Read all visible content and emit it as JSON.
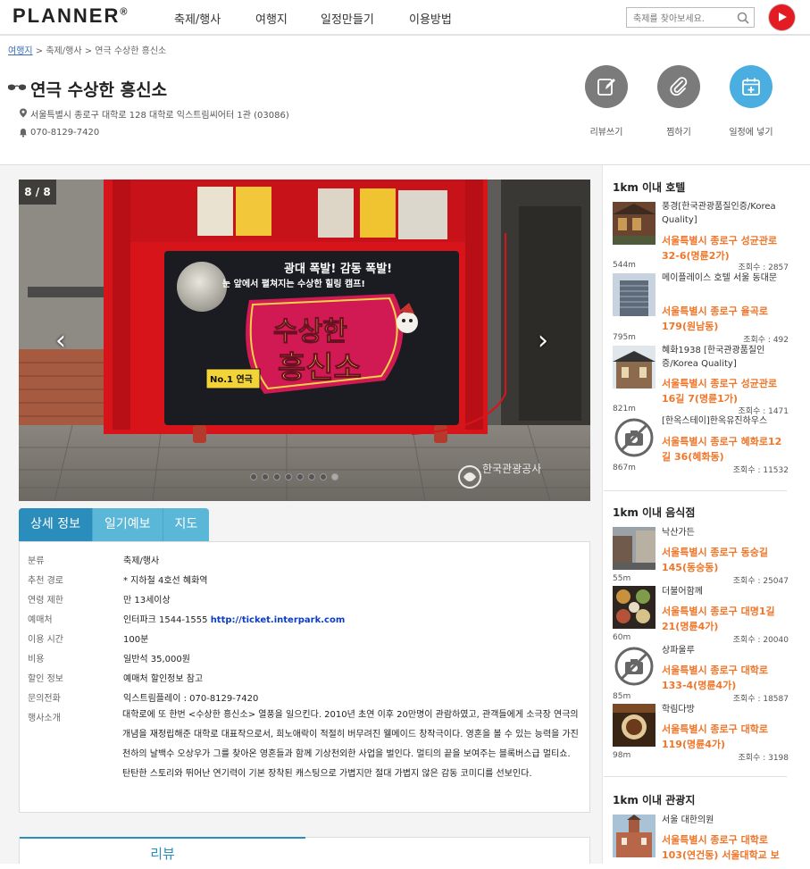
{
  "header": {
    "logo": "PLANNER",
    "logo_mark": "®",
    "nav": [
      "축제/행사",
      "여행지",
      "일정만들기",
      "이용방법"
    ],
    "search_placeholder": "축제를 찾아보세요."
  },
  "breadcrumb": {
    "home": "여행지",
    "cat": "축제/행사",
    "current": "연극 수상한 흥신소"
  },
  "title": "연극 수상한 흥신소",
  "address": "서울특별시 종로구 대학로 128 대학로 익스트림씨어터 1관 (03086)",
  "phone": "070-8129-7420",
  "actions": {
    "review": "리뷰쓰기",
    "like": "찜하기",
    "schedule": "일정에 넣기"
  },
  "slider": {
    "counter": "8 / 8",
    "sign_top": "광대 폭발! 감동 폭발!",
    "sign_sub": "눈 앞에서 펼쳐지는 수상한 힐링 캠프!",
    "sign_main1": "수상한",
    "sign_main2": "흥신소",
    "sign_badge": "No.1 연극",
    "watermark": "한국관광공사",
    "dots": 8,
    "active_dot": 8
  },
  "tabs": [
    "상세 정보",
    "일기예보",
    "지도"
  ],
  "info": {
    "labels": [
      "분류",
      "추천 경로",
      "연령 제한",
      "예매처",
      "이용 시간",
      "비용",
      "할인 정보",
      "문의전화",
      "행사소개"
    ],
    "values": [
      "축제/행사",
      "* 지하철 4호선 혜화역",
      "만 13세이상",
      "인터파크 1544-1555",
      "100분",
      "일반석 35,000원",
      "예매처 할인정보 참고",
      "익스트림플레이 : 070-8129-7420"
    ],
    "url": "http://ticket.interpark.com",
    "description": "대학로에 또 한번 <수상한 흥신소> 열풍을 일으킨다. 2010년 초연 이후 20만명이 관람하였고, 관객들에게 소극장 연극의 개념을 재정립해준 대학로 대표작으로서, 희노애락이 적절히 버무려진 웰메이드 창작극이다. 영혼을 볼 수 있는 능력을 가진 천하의 날백수 오상우가 그를 찾아온 영혼들과 함께 기상천외한 사업을 벌인다. 멀티의 끝을 보여주는 블록버스급 멀티쇼. 탄탄한 스토리와 뛰어난 연기력이 기본 장착된 캐스팅으로 가볍지만 절대 가볍지 않은 감동 코미디를 선보인다."
  },
  "review_tab": "리뷰",
  "hotels": {
    "title": "1km 이내 호텔",
    "items": [
      {
        "name": "풍경[한국관광품질인증/Korea Quality]",
        "addr": "서울특별시 종로구 성균관로 32-6(명륜2가)",
        "dist": "544m",
        "count": "조회수 : 2857"
      },
      {
        "name": "메이플레이스 호텔 서울 동대문",
        "addr": "서울특별시 종로구 율곡로 179(원남동)",
        "dist": "795m",
        "count": "조회수 : 492"
      },
      {
        "name": "혜화1938 [한국관광품질인증/Korea Quality]",
        "addr": "서울특별시 종로구 성균관로16길 7(명륜1가)",
        "dist": "821m",
        "count": "조회수 : 1471"
      },
      {
        "name": "[한옥스테이]한옥유진하우스",
        "addr": "서울특별시 종로구 혜화로12길 36(혜화동)",
        "dist": "867m",
        "count": "조회수 : 11532"
      }
    ]
  },
  "restaurants": {
    "title": "1km 이내 음식점",
    "items": [
      {
        "name": "낙산가든",
        "addr": "서울특별시 종로구 동숭길 145(동숭동)",
        "dist": "55m",
        "count": "조회수 : 25047"
      },
      {
        "name": "더불어함께",
        "addr": "서울특별시 종로구 대명1길 21(명륜4가)",
        "dist": "60m",
        "count": "조회수 : 20040"
      },
      {
        "name": "상파울루",
        "addr": "서울특별시 종로구 대학로 133-4(명륜4가)",
        "dist": "85m",
        "count": "조회수 : 18587"
      },
      {
        "name": "학림다방",
        "addr": "서울특별시 종로구 대학로 119(명륜4가)",
        "dist": "98m",
        "count": "조회수 : 3198"
      }
    ]
  },
  "sights": {
    "title": "1km 이내 관광지",
    "items": [
      {
        "name": "서울 대한의원",
        "addr": "서울특별시 종로구 대학로 103(연건동) 서울대학교 보"
      }
    ]
  },
  "colors": {
    "accent": "#2a8dbb",
    "orange": "#f0762a",
    "icon_gray": "#7b7b7b",
    "icon_blue": "#4aaee0",
    "youtube": "#e31c23"
  },
  "icons": [
    "search-icon",
    "youtube-icon",
    "glasses-icon",
    "location-pin-icon",
    "bell-icon",
    "pencil-icon",
    "paperclip-icon",
    "calendar-plus-icon",
    "prev-arrow-icon",
    "next-arrow-icon",
    "no-camera-icon"
  ]
}
